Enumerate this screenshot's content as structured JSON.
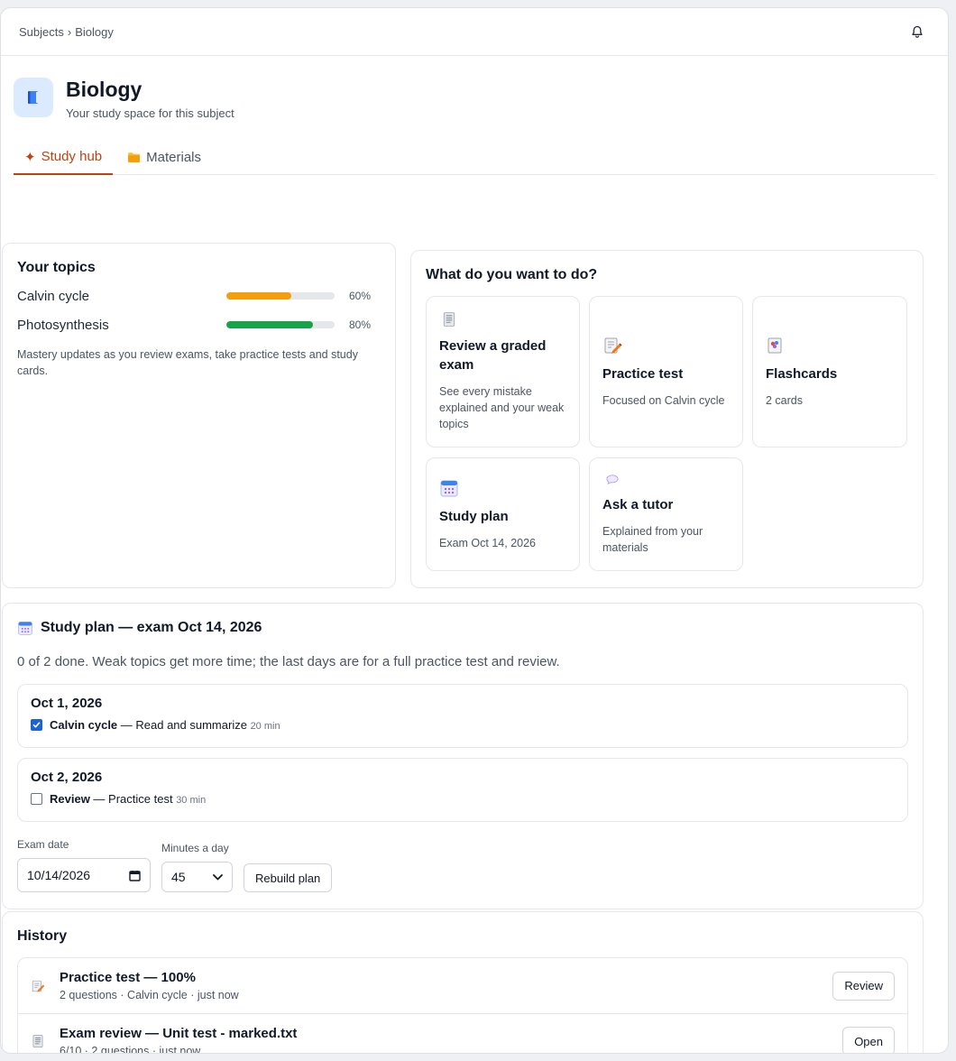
{
  "breadcrumb": {
    "root": "Subjects",
    "separator": "›",
    "current": "Biology"
  },
  "subject": {
    "title": "Biology",
    "subtitle": "Your study space for this subject",
    "icon": "book-icon"
  },
  "tabs": [
    {
      "label": "Study hub",
      "glyph": "✦",
      "active": true
    },
    {
      "label": "Materials",
      "icon": "folder-icon",
      "active": false
    }
  ],
  "topics": {
    "title": "Your topics",
    "items": [
      {
        "name": "Calvin cycle",
        "percent_label": "60%",
        "mastery": 0.6,
        "color": "#f59e0b"
      },
      {
        "name": "Photosynthesis",
        "percent_label": "80%",
        "mastery": 0.8,
        "color": "#16a34a"
      }
    ],
    "note": "Mastery updates as you review exams, take practice tests and study cards."
  },
  "actions": {
    "title": "What do you want to do?",
    "items": [
      {
        "title": "Review a graded exam",
        "desc": "See every mistake explained and your weak topics",
        "icon": "document-icon"
      },
      {
        "title": "Practice test",
        "desc": "Focused on Calvin cycle",
        "icon": "pencil-paper-icon"
      },
      {
        "title": "Flashcards",
        "desc": "2 cards",
        "icon": "flashcards-icon"
      },
      {
        "title": "Study plan",
        "desc": "Exam Oct 14, 2026",
        "icon": "calendar-icon"
      },
      {
        "title": "Ask a tutor",
        "desc": "Explained from your materials",
        "icon": "speech-bubble-icon"
      }
    ]
  },
  "plan": {
    "title": "Study plan — exam Oct 14, 2026",
    "summary": "0 of 2 done. Weak topics get more time; the last days are for a full practice test and review.",
    "days": [
      {
        "date": "Oct 1, 2026",
        "topic": "Calvin cycle",
        "task": " — Read and summarize",
        "minutes": "20 min",
        "done": true
      },
      {
        "date": "Oct 2, 2026",
        "topic": "Review",
        "task": " — Practice test",
        "minutes": "30 min",
        "done": false
      }
    ],
    "exam_date_label": "Exam date",
    "exam_date_value": "10/14/2026",
    "minutes_label": "Minutes a day",
    "minutes_value": "45",
    "rebuild_label": "Rebuild plan"
  },
  "history": {
    "title": "History",
    "items": [
      {
        "title": "Practice test — 100%",
        "meta": "2 questions · Calvin cycle · just now",
        "action": "Review",
        "icon": "pencil-paper-icon"
      },
      {
        "title": "Exam review — Unit test - marked.txt",
        "meta": "6/10 · 2 questions · just now",
        "action": "Open",
        "icon": "document-icon"
      }
    ]
  },
  "colors": {
    "accent": "#c2410c",
    "checkbox": "#1d63d8"
  }
}
